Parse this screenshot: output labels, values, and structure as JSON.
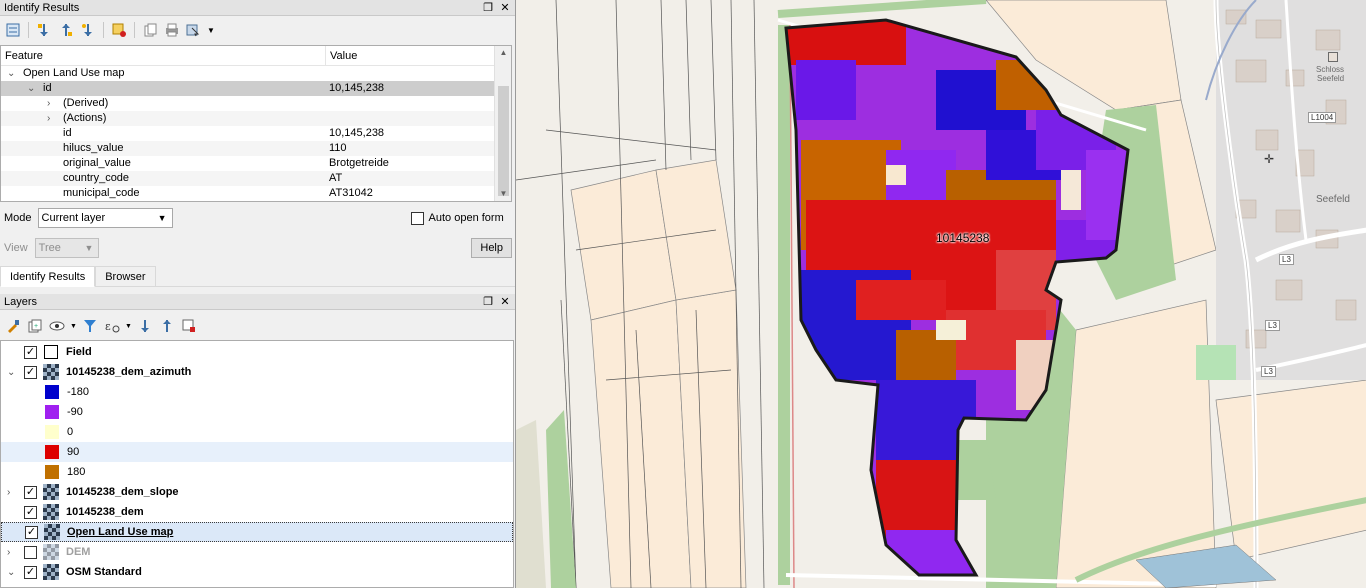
{
  "identify": {
    "title": "Identify Results",
    "columns": {
      "feature": "Feature",
      "value": "Value"
    },
    "rows": [
      {
        "feature": "Open Land Use map",
        "value": ""
      },
      {
        "feature": "id",
        "value": "10,145,238"
      },
      {
        "feature": "(Derived)",
        "value": ""
      },
      {
        "feature": "(Actions)",
        "value": ""
      },
      {
        "feature": "id",
        "value": "10,145,238"
      },
      {
        "feature": "hilucs_value",
        "value": "110"
      },
      {
        "feature": "original_value",
        "value": "Brotgetreide"
      },
      {
        "feature": "country_code",
        "value": "AT"
      },
      {
        "feature": "municipal_code",
        "value": "AT31042"
      }
    ],
    "mode_label": "Mode",
    "mode_value": "Current layer",
    "auto_open_label": "Auto open form",
    "view_label": "View",
    "view_value": "Tree",
    "help_label": "Help"
  },
  "tabs": [
    "Identify Results",
    "Browser"
  ],
  "layers": {
    "title": "Layers",
    "items": [
      {
        "name": "Field"
      },
      {
        "name": "10145238_dem_azimuth"
      },
      {
        "name": "10145238_dem_slope"
      },
      {
        "name": "10145238_dem"
      },
      {
        "name": "Open Land Use map"
      },
      {
        "name": "DEM"
      },
      {
        "name": "OSM Standard"
      }
    ],
    "legend": [
      {
        "label": "-180",
        "color": "#0000cc"
      },
      {
        "label": "-90",
        "color": "#a020f0"
      },
      {
        "label": "0",
        "color": "#ffffcc"
      },
      {
        "label": "90",
        "color": "#dd0000"
      },
      {
        "label": "180",
        "color": "#c07000"
      }
    ]
  },
  "map": {
    "field_label": "10145238",
    "places": [
      "Schloss",
      "Seefeld",
      "Seefeld"
    ],
    "roads": [
      "L1004",
      "L3",
      "L3",
      "L3"
    ]
  }
}
